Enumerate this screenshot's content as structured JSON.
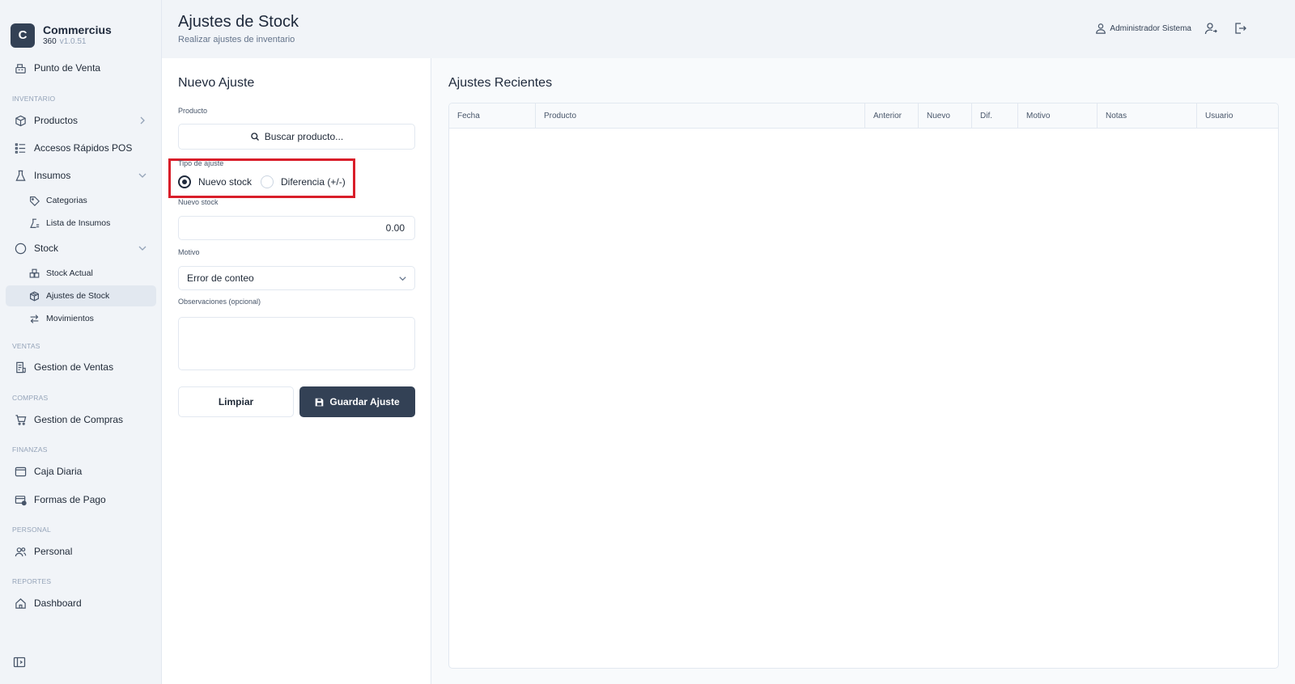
{
  "brand": {
    "logo_letter": "C",
    "name": "Commercius",
    "sub": "360",
    "version": "v1.0.51"
  },
  "sidebar": {
    "pos_label": "Punto de Venta",
    "sections": {
      "inventario": "INVENTARIO",
      "ventas": "VENTAS",
      "compras": "COMPRAS",
      "finanzas": "FINANZAS",
      "personal": "PERSONAL",
      "reportes": "REPORTES"
    },
    "items": {
      "productos": "Productos",
      "accesos": "Accesos Rápidos POS",
      "insumos": "Insumos",
      "categorias": "Categorias",
      "lista_insumos": "Lista de Insumos",
      "stock": "Stock",
      "stock_actual": "Stock Actual",
      "ajustes_stock": "Ajustes de Stock",
      "movimientos": "Movimientos",
      "gestion_ventas": "Gestion de Ventas",
      "gestion_compras": "Gestion de Compras",
      "caja_diaria": "Caja Diaria",
      "formas_pago": "Formas de Pago",
      "personal": "Personal",
      "dashboard": "Dashboard"
    },
    "active": "ajustes_stock"
  },
  "header": {
    "title": "Ajustes de Stock",
    "subtitle": "Realizar ajustes de inventario",
    "user_name": "Administrador Sistema"
  },
  "form": {
    "title": "Nuevo Ajuste",
    "product_label": "Producto",
    "product_search": "Buscar producto...",
    "type_label": "Tipo de ajuste",
    "type_options": [
      "Nuevo stock",
      "Diferencia (+/-)"
    ],
    "type_selected": "Nuevo stock",
    "new_stock_label": "Nuevo stock",
    "new_stock_value": "0.00",
    "reason_label": "Motivo",
    "reason_value": "Error de conteo",
    "notes_label": "Observaciones (opcional)",
    "clear_button": "Limpiar",
    "save_button": "Guardar Ajuste"
  },
  "recent": {
    "title": "Ajustes Recientes",
    "columns": [
      "Fecha",
      "Producto",
      "Anterior",
      "Nuevo",
      "Dif.",
      "Motivo",
      "Notas",
      "Usuario"
    ],
    "rows": []
  },
  "colors": {
    "accent": "#334155",
    "highlight": "#d91e2a",
    "sidebar_bg": "#f1f4f8"
  }
}
